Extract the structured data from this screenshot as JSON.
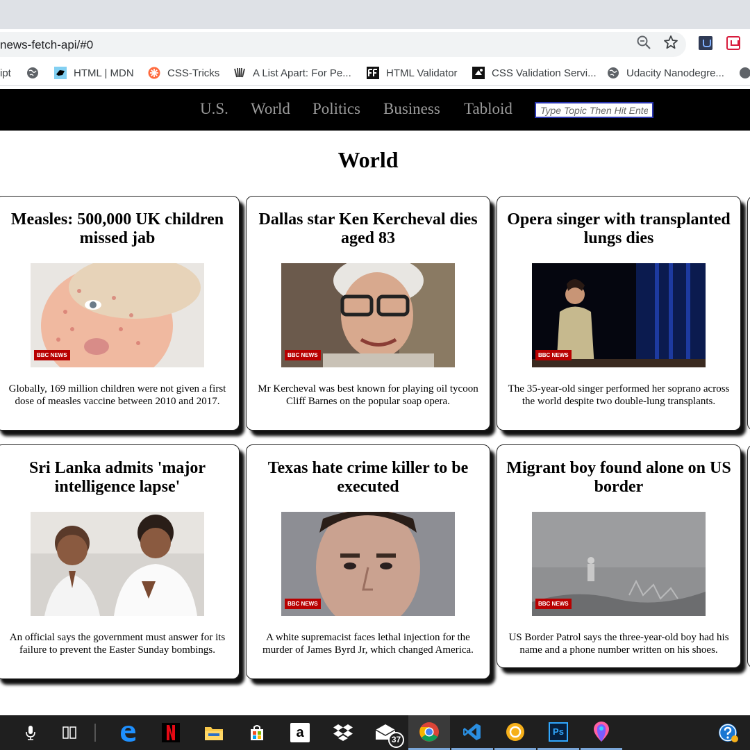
{
  "browser": {
    "url": "news-fetch-api/#0",
    "bookmarks": [
      {
        "label": "ipt",
        "icon": "truncated-bookmark"
      },
      {
        "label": "",
        "icon": "globe-icon"
      },
      {
        "label": "HTML | MDN",
        "icon": "mdn-icon"
      },
      {
        "label": "CSS-Tricks",
        "icon": "css-tricks-icon"
      },
      {
        "label": "A List Apart: For Pe...",
        "icon": "a-list-apart-icon"
      },
      {
        "label": "HTML Validator",
        "icon": "html-validator-icon"
      },
      {
        "label": "CSS Validation Servi...",
        "icon": "css-validation-icon"
      },
      {
        "label": "Udacity Nanodegre...",
        "icon": "globe-icon"
      }
    ]
  },
  "nav": {
    "links": [
      "U.S.",
      "World",
      "Politics",
      "Business",
      "Tabloid"
    ],
    "search_placeholder": "Type Topic Then Hit Enter"
  },
  "page": {
    "title": "World",
    "badge": "BBC NEWS",
    "articles": [
      {
        "title": "Measles: 500,000 UK children missed jab",
        "description": "Globally, 169 million children were not given a first dose of measles vaccine between 2010 and 2017."
      },
      {
        "title": "Dallas star Ken Kercheval dies aged 83",
        "description": "Mr Kercheval was best known for playing oil tycoon Cliff Barnes on the popular soap opera."
      },
      {
        "title": "Opera singer with transplanted lungs dies",
        "description": "The 35-year-old singer performed her soprano across the world despite two double-lung transplants."
      },
      {
        "title": "Sri Lanka admits 'major intelligence lapse'",
        "description": "An official says the government must answer for its failure to prevent the Easter Sunday bombings."
      },
      {
        "title": "Texas hate crime killer to be executed",
        "description": "A white supremacist faces lethal injection for the murder of James Byrd Jr, which changed America."
      },
      {
        "title": "Migrant boy found alone on US border",
        "description": "US Border Patrol says the three-year-old boy had his name and a phone number written on his shoes."
      }
    ]
  },
  "taskbar": {
    "mail_badge": "37",
    "apps": [
      "microphone-icon",
      "task-view-icon",
      "edge-icon",
      "netflix-icon",
      "file-explorer-icon",
      "store-icon",
      "amazon-icon",
      "dropbox-icon",
      "mail-icon",
      "chrome-icon",
      "vscode-icon",
      "app-circle-icon",
      "photoshop-icon",
      "paint-3d-icon",
      "help-icon"
    ]
  },
  "colors": {
    "navbar_bg": "#000000",
    "nav_link": "#9a9a9a",
    "bbc_red": "#b80000",
    "input_border": "#2a36b1"
  }
}
